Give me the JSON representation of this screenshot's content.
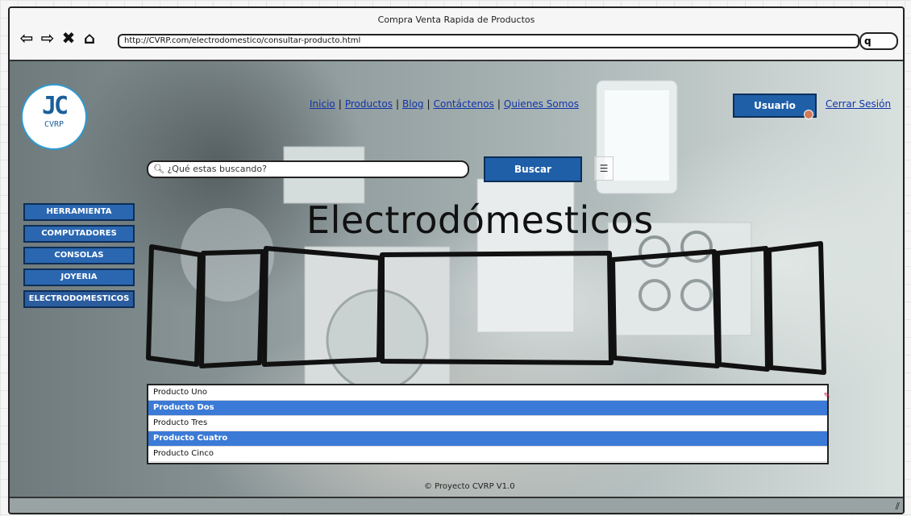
{
  "window": {
    "title": "Compra Venta Rapida de Productos"
  },
  "browser": {
    "url": "http://CVRP.com/electrodomestico/consultar-producto.html",
    "search_glyph": "q"
  },
  "logo": {
    "mark": "JC",
    "text": "CVRP"
  },
  "nav": {
    "items": [
      "Inicio",
      "Productos",
      "Blog",
      "Contáctenos",
      "Quienes Somos"
    ]
  },
  "user_button": "Usuario",
  "logout_link": "Cerrar Sesión",
  "search": {
    "placeholder": "¿Qué estas buscando?",
    "button": "Buscar"
  },
  "categories": [
    "HERRAMIENTA",
    "COMPUTADORES",
    "CONSOLAS",
    "JOYERIA",
    "ELECTRODOMESTICOS"
  ],
  "heading": "Electrodómesticos",
  "products": [
    {
      "name": "Producto Uno",
      "selected": false
    },
    {
      "name": "Producto Dos",
      "selected": true
    },
    {
      "name": "Producto Tres",
      "selected": false
    },
    {
      "name": "Producto Cuatro",
      "selected": true
    },
    {
      "name": "Producto Cinco",
      "selected": false
    }
  ],
  "footer": "© Proyecto CVRP V1.0",
  "colors": {
    "button_blue": "#1f5fa8",
    "selection_blue": "#3b7ad6",
    "link": "#1234a8"
  }
}
